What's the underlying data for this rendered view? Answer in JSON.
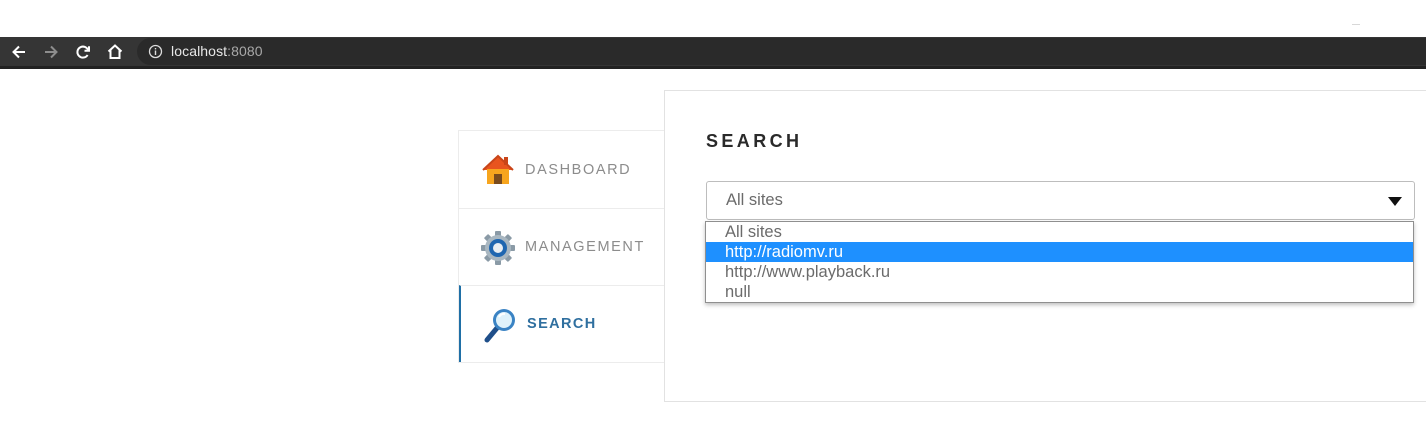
{
  "browser": {
    "url_host": "localhost",
    "url_port": ":8080",
    "icons": [
      "back-icon",
      "forward-icon",
      "reload-icon",
      "home-icon",
      "info-icon"
    ]
  },
  "sidebar": {
    "items": [
      {
        "label": "DASHBOARD",
        "icon": "house-icon",
        "active": false
      },
      {
        "label": "MANAGEMENT",
        "icon": "gear-icon",
        "active": false
      },
      {
        "label": "SEARCH",
        "icon": "magnifier-icon",
        "active": true
      }
    ]
  },
  "main": {
    "title": "SEARCH",
    "site_select": {
      "value": "All sites",
      "options": [
        "All sites",
        "http://radiomv.ru",
        "http://www.playback.ru",
        "null"
      ],
      "highlighted_option": "http://radiomv.ru"
    }
  },
  "colors": {
    "accent": "#1e90ff",
    "active_nav": "#2f6f9f",
    "browser_bar": "#353535"
  }
}
